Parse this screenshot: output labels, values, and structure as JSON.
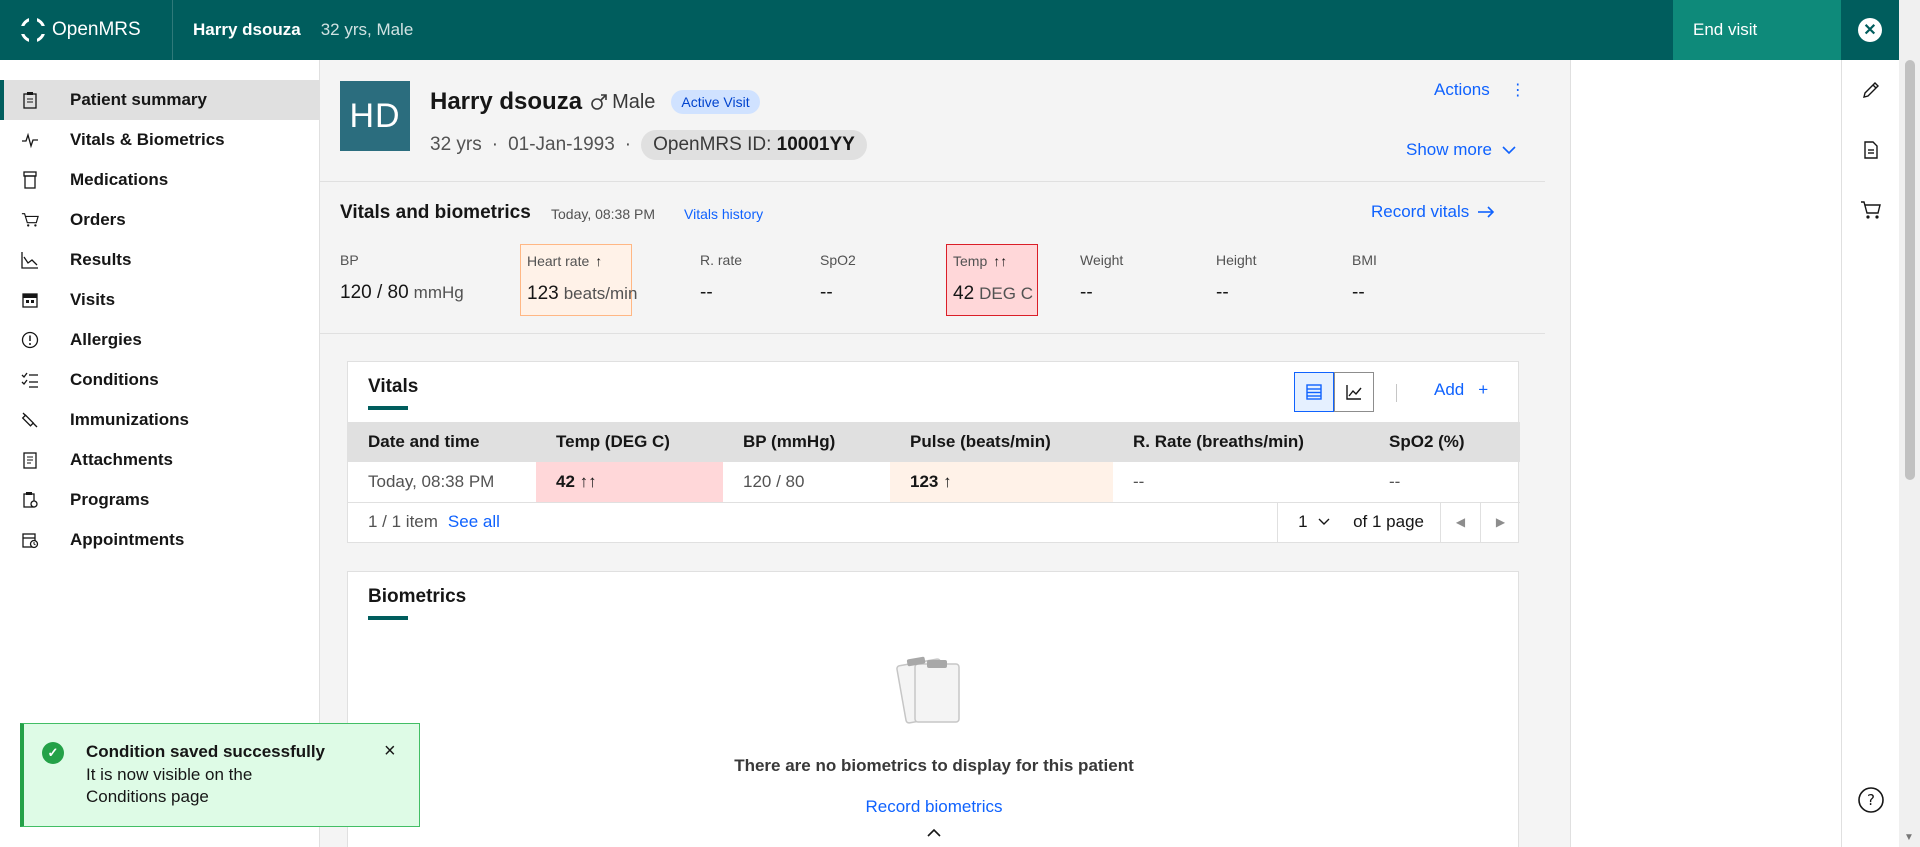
{
  "header": {
    "logo_text": "OpenMRS",
    "patient_name": "Harry dsouza",
    "patient_meta": "32 yrs, Male",
    "end_visit_label": "End visit"
  },
  "nav": {
    "items": [
      {
        "label": "Patient summary",
        "icon": "clipboard-icon",
        "active": true
      },
      {
        "label": "Vitals & Biometrics",
        "icon": "activity-icon"
      },
      {
        "label": "Medications",
        "icon": "medication-icon"
      },
      {
        "label": "Orders",
        "icon": "cart-icon"
      },
      {
        "label": "Results",
        "icon": "chart-icon"
      },
      {
        "label": "Visits",
        "icon": "calendar-icon"
      },
      {
        "label": "Allergies",
        "icon": "warning-icon"
      },
      {
        "label": "Conditions",
        "icon": "checklist-icon"
      },
      {
        "label": "Immunizations",
        "icon": "syringe-icon"
      },
      {
        "label": "Attachments",
        "icon": "attachment-icon"
      },
      {
        "label": "Programs",
        "icon": "program-icon"
      },
      {
        "label": "Appointments",
        "icon": "appointment-icon"
      }
    ]
  },
  "banner": {
    "initials": "HD",
    "name": "Harry dsouza",
    "gender": "Male",
    "visit_tag": "Active Visit",
    "age": "32 yrs",
    "dob": "01-Jan-1993",
    "id_label": "OpenMRS ID:",
    "id_value": "10001YY",
    "actions_label": "Actions",
    "show_more_label": "Show more"
  },
  "vitals_header": {
    "title": "Vitals and biometrics",
    "date": "Today, 08:38 PM",
    "history_link": "Vitals history",
    "record_link": "Record vitals",
    "items": [
      {
        "label": "BP",
        "value": "120 / 80",
        "unit": "mmHg",
        "status": "normal",
        "arrow": ""
      },
      {
        "label": "Heart rate",
        "value": "123",
        "unit": "beats/min",
        "status": "warn",
        "arrow": "↑"
      },
      {
        "label": "R. rate",
        "value": "--",
        "unit": "",
        "status": "normal",
        "arrow": ""
      },
      {
        "label": "SpO2",
        "value": "--",
        "unit": "",
        "status": "normal",
        "arrow": ""
      },
      {
        "label": "Temp",
        "value": "42",
        "unit": "DEG C",
        "status": "crit",
        "arrow": "↑↑"
      },
      {
        "label": "Weight",
        "value": "--",
        "unit": "",
        "status": "normal",
        "arrow": ""
      },
      {
        "label": "Height",
        "value": "--",
        "unit": "",
        "status": "normal",
        "arrow": ""
      },
      {
        "label": "BMI",
        "value": "--",
        "unit": "",
        "status": "normal",
        "arrow": ""
      }
    ]
  },
  "vitals_card": {
    "title": "Vitals",
    "add_label": "Add",
    "add_symbol": "+",
    "columns": [
      "Date and time",
      "Temp (DEG C)",
      "BP (mmHg)",
      "Pulse (beats/min)",
      "R. Rate (breaths/min)",
      "SpO2 (%)"
    ],
    "rows": [
      {
        "date": "Today, 08:38 PM",
        "temp": "42 ↑↑",
        "bp": "120 / 80",
        "pulse": "123 ↑",
        "rrate": "--",
        "spo2": "--"
      }
    ],
    "item_count": "1 / 1 item",
    "see_all": "See all",
    "page": "1",
    "page_of": "of 1 page"
  },
  "biometrics_card": {
    "title": "Biometrics",
    "empty_text": "There are no biometrics to display for this patient",
    "record_link": "Record biometrics"
  },
  "toast": {
    "title": "Condition saved successfully",
    "subtitle": "It is now visible on the Conditions page",
    "close": "×"
  },
  "colors": {
    "brand": "#005d5d",
    "link": "#0f62fe",
    "critical_bg": "#ffd7d9",
    "warning_bg": "#fff2e8",
    "success_bg": "#defbe6"
  }
}
